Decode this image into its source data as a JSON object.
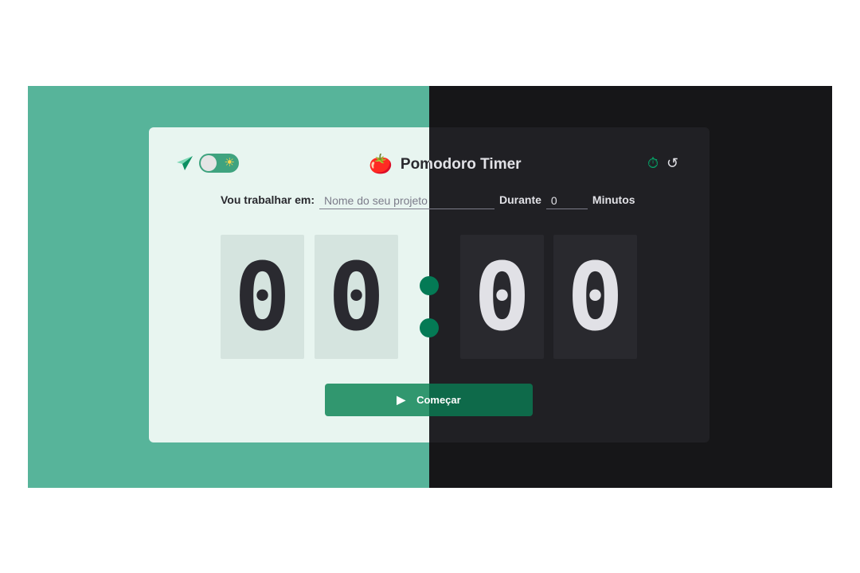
{
  "header": {
    "title": "Pomodoro Timer",
    "logo_icon": "tomato-icon",
    "theme_icons": [
      "paper-plane-icon",
      "sun-icon"
    ],
    "nav_icons": [
      "timer-icon",
      "history-icon"
    ]
  },
  "form": {
    "task_label": "Vou trabalhar em:",
    "task_placeholder": "Nome do seu projeto",
    "duration_label": "Durante",
    "minutes_value": "0",
    "minutes_label": "Minutos"
  },
  "countdown": {
    "minute_tens": "0",
    "minute_ones": "0",
    "second_tens": "0",
    "second_ones": "0"
  },
  "start_button": {
    "label": "Começar",
    "icon": "play-icon"
  },
  "colors": {
    "light_background": "#57b49a",
    "dark_background": "#161618",
    "accent": "#047a55"
  }
}
